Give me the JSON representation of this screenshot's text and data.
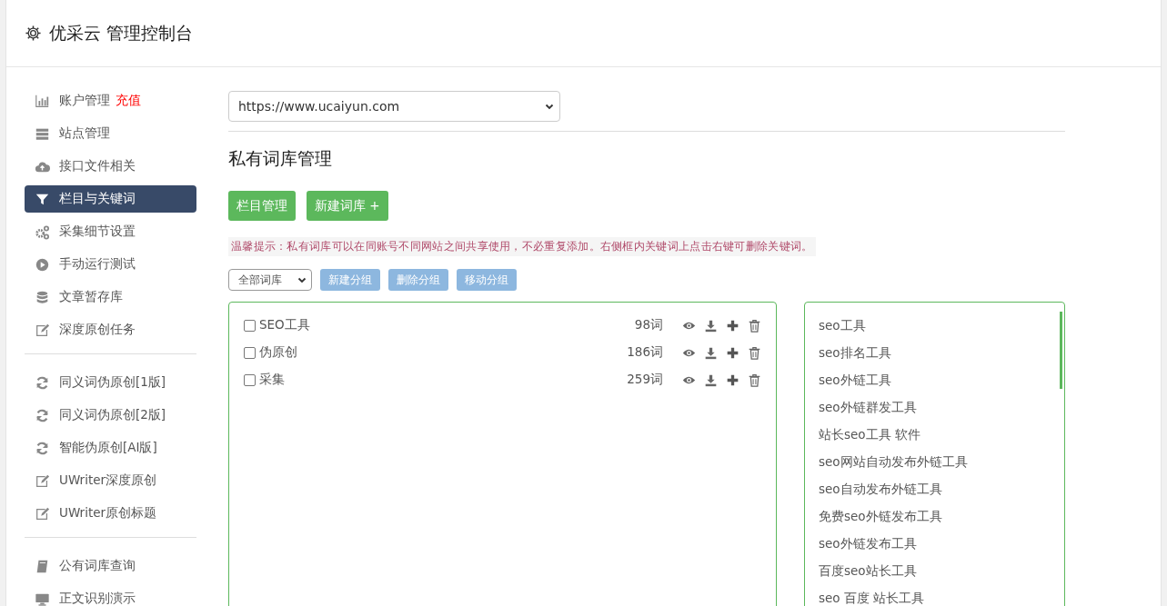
{
  "header": {
    "title": "优采云 管理控制台"
  },
  "sidebar": {
    "groups": [
      {
        "items": [
          {
            "label": "账户管理",
            "badge": "充值",
            "selected": false
          },
          {
            "label": "站点管理",
            "selected": false
          },
          {
            "label": "接口文件相关",
            "selected": false
          },
          {
            "label": "栏目与关键词",
            "selected": true
          },
          {
            "label": "采集细节设置",
            "selected": false
          },
          {
            "label": "手动运行测试",
            "selected": false
          },
          {
            "label": "文章暂存库",
            "selected": false
          },
          {
            "label": "深度原创任务",
            "selected": false
          }
        ]
      },
      {
        "items": [
          {
            "label": "同义词伪原创[1版]",
            "selected": false
          },
          {
            "label": "同义词伪原创[2版]",
            "selected": false
          },
          {
            "label": "智能伪原创[AI版]",
            "selected": false
          },
          {
            "label": "UWriter深度原创",
            "selected": false
          },
          {
            "label": "UWriter原创标题",
            "selected": false
          }
        ]
      },
      {
        "items": [
          {
            "label": "公有词库查询",
            "selected": false
          },
          {
            "label": "正文识别演示",
            "selected": false
          }
        ]
      }
    ]
  },
  "site_select": {
    "value": "https://www.ucaiyun.com"
  },
  "heading": "私有词库管理",
  "actions": [
    "栏目管理",
    "新建词库 +"
  ],
  "tip": "温馨提示：私有词库可以在同账号不同网站之间共享使用，不必重复添加。右侧框内关键词上点击右键可删除关键词。",
  "filter_select": {
    "value": "全部词库"
  },
  "group_buttons": [
    "新建分组",
    "删除分组",
    "移动分组"
  ],
  "libraries": [
    {
      "name": "SEO工具",
      "count": "98词",
      "checked": false
    },
    {
      "name": "伪原创",
      "count": "186词",
      "checked": false
    },
    {
      "name": "采集",
      "count": "259词",
      "checked": false
    }
  ],
  "keywords": [
    "seo工具",
    "seo排名工具",
    "seo外链工具",
    "seo外链群发工具",
    "站长seo工具 软件",
    "seo网站自动发布外链工具",
    "seo自动发布外链工具",
    "免费seo外链发布工具",
    "seo外链发布工具",
    "百度seo站长工具",
    "seo 百度 站长工具"
  ]
}
